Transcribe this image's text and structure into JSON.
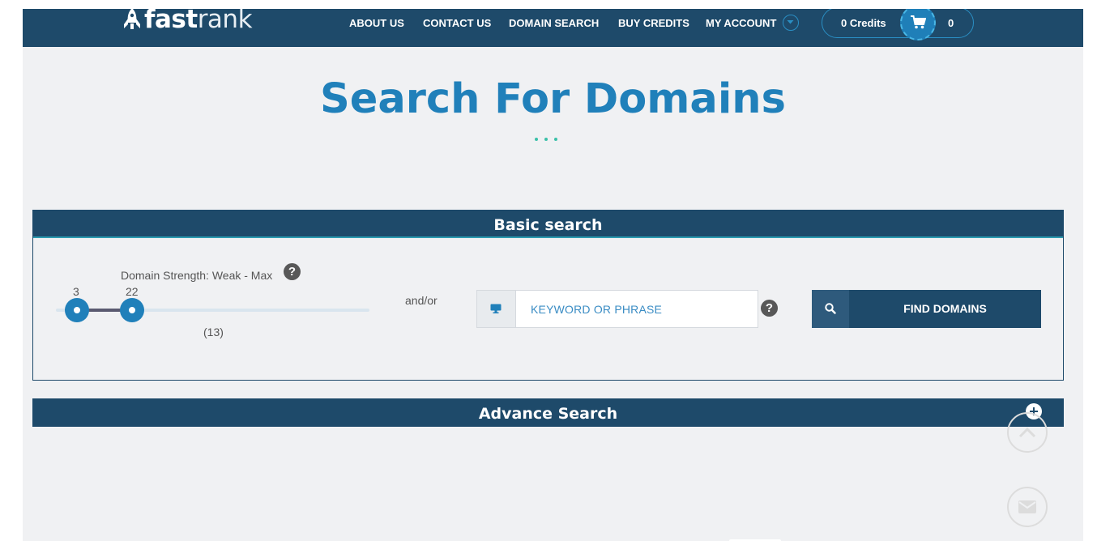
{
  "brand": {
    "logo_bold": "fast",
    "logo_light": "rank"
  },
  "nav": {
    "about": "ABOUT US",
    "contact": "CONTACT US",
    "domain_search": "DOMAIN SEARCH",
    "buy_credits": "BUY CREDITS",
    "my_account": "MY ACCOUNT"
  },
  "header": {
    "credits": "0 Credits",
    "cart_count": "0"
  },
  "page": {
    "title": "Search For Domains"
  },
  "basic_search": {
    "heading": "Basic search",
    "strength_label": "Domain Strength: Weak - Max",
    "slider_min": "3",
    "slider_max": "22",
    "slider_count": "(13)",
    "andor": "and/or",
    "keyword_placeholder": "KEYWORD OR PHRASE",
    "find_label": "FIND DOMAINS",
    "help_glyph": "?"
  },
  "advance_search": {
    "heading": "Advance Search"
  },
  "colors": {
    "navy": "#1e4a6a",
    "accent_blue": "#2080ba",
    "teal_dots": "#3ac0a8",
    "background": "#f0f1f3"
  }
}
